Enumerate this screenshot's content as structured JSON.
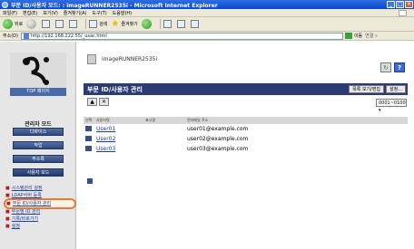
{
  "window": {
    "title": "부문 ID/사용자 모드: : imageRUNNER2535i - Microsoft Internet Explorer",
    "controls": [
      "_",
      "□",
      "×"
    ]
  },
  "menu": [
    "파일(F)",
    "편집(E)",
    "보기(V)",
    "즐겨찾기(A)",
    "도구(T)",
    "도움말(H)"
  ],
  "toolbar": {
    "back": "뒤로",
    "search": "검색",
    "favorites": "즐겨찾기"
  },
  "address": {
    "label": "주소(D)",
    "url": "http://192.168.222.55/_usac.html",
    "go": "이동",
    "links": "연결 »"
  },
  "sidebar": {
    "logo_label": "TOP 페이지",
    "mode_title": "관리자 모드",
    "mode_buttons": [
      "디바이스",
      "작업",
      "주소록",
      "사용자 모드"
    ],
    "items": [
      "시스템관리 설정",
      "LDAP서버 등록",
      "부문 ID/사용자 관리",
      "부문별 ID 관리",
      "기록/바로가기",
      "설정"
    ]
  },
  "main": {
    "device": "imageRUNNER2535i",
    "refresh_icon": "refresh-icon",
    "help_icon": "help-icon",
    "section_title": "부문 ID/사용자 관리",
    "actions": [
      "목록 보기/편집",
      "설정..."
    ],
    "icon_add": "▲",
    "icon_delete": "✕",
    "range": "0001~0100 ▾",
    "columns": [
      "선택",
      "사용자명",
      "표시명",
      "전자메일 주소"
    ],
    "rows": [
      {
        "name": "User01",
        "email": "user01@example.com"
      },
      {
        "name": "User02",
        "email": "user02@example.com"
      },
      {
        "name": "User03",
        "email": "user03@example.com"
      }
    ]
  }
}
